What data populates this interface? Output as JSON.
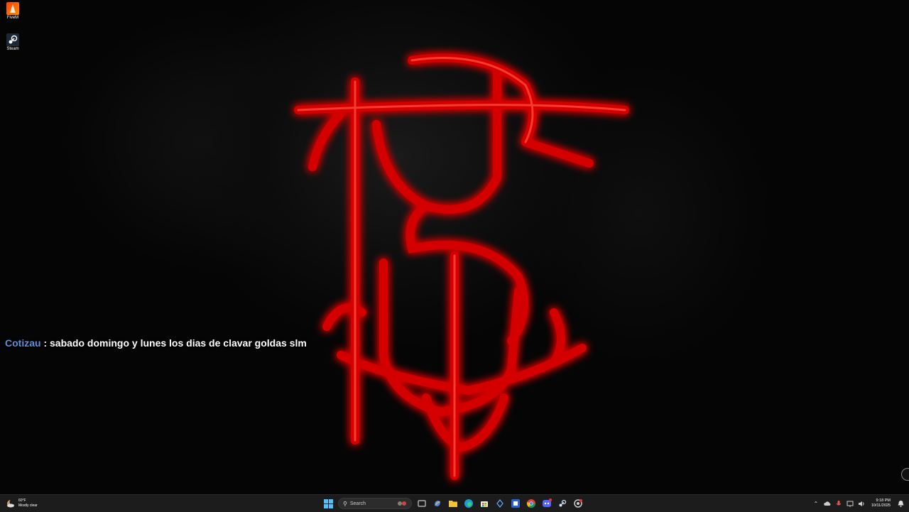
{
  "desktop": {
    "icons": [
      {
        "label": "FiveM"
      },
      {
        "label": "Steam"
      }
    ]
  },
  "chat": {
    "author": "Cotizau",
    "separator": " : ",
    "message": "sabado domingo y lunes los dias de clavar goldas slm"
  },
  "taskbar": {
    "weather": {
      "temp": "60°F",
      "condition": "Mostly clear"
    },
    "search": {
      "placeholder": "Search"
    },
    "apps": [
      "file-explorer-icon",
      "copilot-icon",
      "folder-icon",
      "edge-icon",
      "store-icon",
      "diamond-app-icon",
      "discord-app-icon",
      "chrome-icon",
      "discord-icon",
      "steam-icon",
      "settings-icon"
    ],
    "clock": {
      "time": "9:18 PM",
      "date": "10/11/2025"
    }
  },
  "colors": {
    "accent": "#4cc2ff",
    "chat_author": "#5f8fd6",
    "emblem": "#d40000",
    "taskbar_bg": "#1c1c1c"
  }
}
